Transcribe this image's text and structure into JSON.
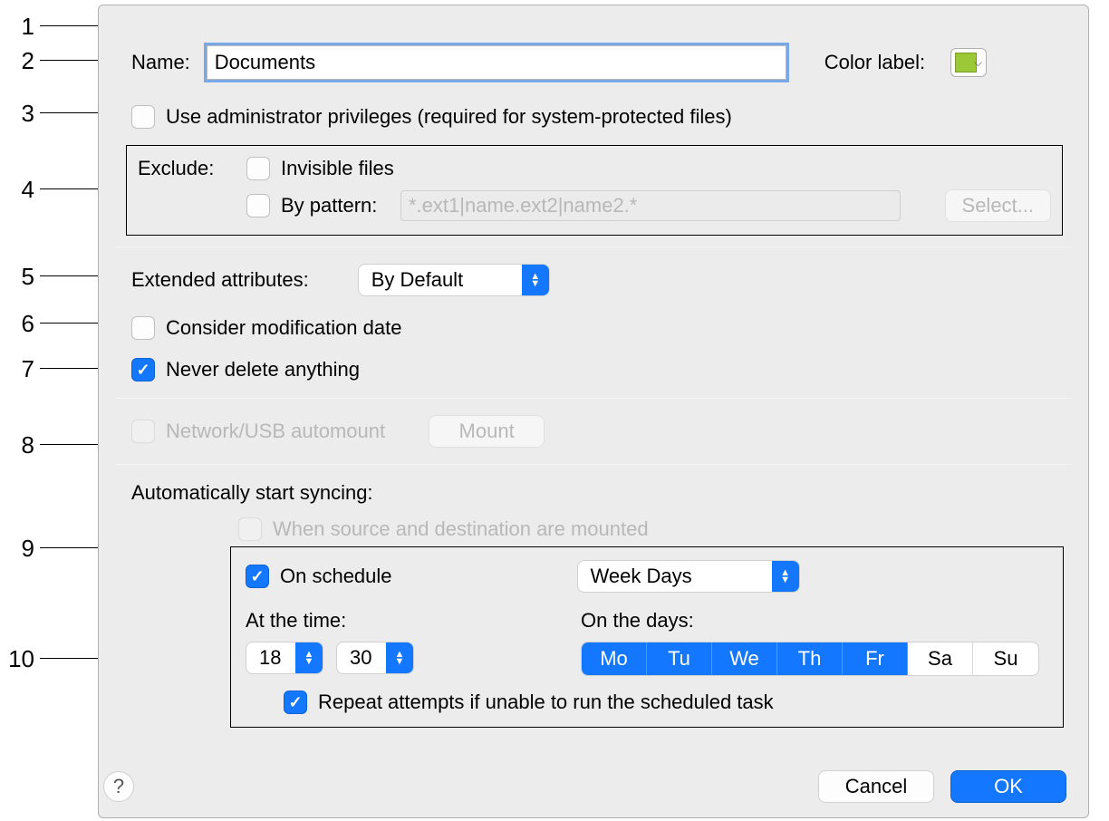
{
  "callouts": [
    "1",
    "2",
    "3",
    "4",
    "5",
    "6",
    "7",
    "8",
    "9",
    "10"
  ],
  "name": {
    "label": "Name:",
    "value": "Documents"
  },
  "colorLabel": {
    "label": "Color label:",
    "swatch": "#9bc837"
  },
  "adminPriv": {
    "label": "Use administrator privileges (required for system-protected files)",
    "checked": false
  },
  "exclude": {
    "label": "Exclude:",
    "invisible": {
      "label": "Invisible files",
      "checked": false
    },
    "byPattern": {
      "label": "By pattern:",
      "checked": false,
      "placeholder": "*.ext1|name.ext2|name2.*"
    },
    "selectBtn": "Select..."
  },
  "extAttr": {
    "label": "Extended attributes:",
    "value": "By Default"
  },
  "considerMod": {
    "label": "Consider modification date",
    "checked": false
  },
  "neverDelete": {
    "label": "Never delete anything",
    "checked": true
  },
  "automount": {
    "label": "Network/USB automount",
    "checked": false,
    "btn": "Mount"
  },
  "autoStart": {
    "label": "Automatically start syncing:",
    "whenMounted": {
      "label": "When source and destination are mounted",
      "checked": false
    },
    "schedule": {
      "onSchedule": {
        "label": "On schedule",
        "checked": true
      },
      "freq": "Week Days",
      "atTimeLabel": "At the time:",
      "hour": "18",
      "minute": "30",
      "onDaysLabel": "On the days:",
      "days": [
        {
          "abbr": "Mo",
          "on": true
        },
        {
          "abbr": "Tu",
          "on": true
        },
        {
          "abbr": "We",
          "on": true
        },
        {
          "abbr": "Th",
          "on": true
        },
        {
          "abbr": "Fr",
          "on": true
        },
        {
          "abbr": "Sa",
          "on": false
        },
        {
          "abbr": "Su",
          "on": false
        }
      ],
      "repeat": {
        "label": "Repeat attempts if unable to run the scheduled task",
        "checked": true
      }
    }
  },
  "help": "?",
  "cancel": "Cancel",
  "ok": "OK"
}
